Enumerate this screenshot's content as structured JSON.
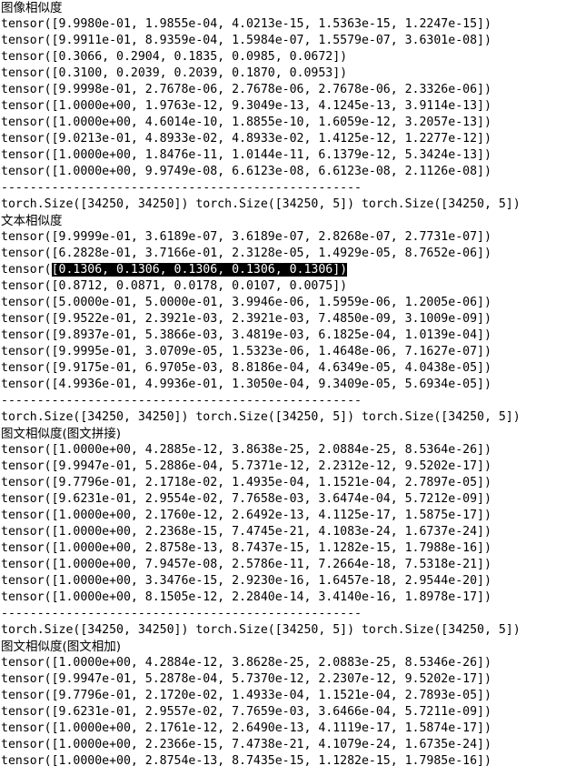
{
  "lines": [
    {
      "kind": "heading",
      "text": "图像相似度"
    },
    {
      "kind": "text",
      "text": "tensor([9.9980e-01, 1.9855e-04, 4.0213e-15, 1.5363e-15, 1.2247e-15])"
    },
    {
      "kind": "text",
      "text": "tensor([9.9911e-01, 8.9359e-04, 1.5984e-07, 1.5579e-07, 3.6301e-08])"
    },
    {
      "kind": "text",
      "text": "tensor([0.3066, 0.2904, 0.1835, 0.0985, 0.0672])"
    },
    {
      "kind": "text",
      "text": "tensor([0.3100, 0.2039, 0.2039, 0.1870, 0.0953])"
    },
    {
      "kind": "text",
      "text": "tensor([9.9998e-01, 2.7678e-06, 2.7678e-06, 2.7678e-06, 2.3326e-06])"
    },
    {
      "kind": "text",
      "text": "tensor([1.0000e+00, 1.9763e-12, 9.3049e-13, 4.1245e-13, 3.9114e-13])"
    },
    {
      "kind": "text",
      "text": "tensor([1.0000e+00, 4.6014e-10, 1.8855e-10, 1.6059e-12, 3.2057e-13])"
    },
    {
      "kind": "text",
      "text": "tensor([9.0213e-01, 4.8933e-02, 4.8933e-02, 1.4125e-12, 1.2277e-12])"
    },
    {
      "kind": "text",
      "text": "tensor([1.0000e+00, 1.8476e-11, 1.0144e-11, 6.1379e-12, 5.3424e-13])"
    },
    {
      "kind": "text",
      "text": "tensor([1.0000e+00, 9.9749e-08, 6.6123e-08, 6.6123e-08, 2.1126e-08])"
    },
    {
      "kind": "sep",
      "text": "--------------------------------------------------"
    },
    {
      "kind": "text",
      "text": "torch.Size([34250, 34250]) torch.Size([34250, 5]) torch.Size([34250, 5])"
    },
    {
      "kind": "heading",
      "text": "文本相似度"
    },
    {
      "kind": "text",
      "text": "tensor([9.9999e-01, 3.6189e-07, 3.6189e-07, 2.8268e-07, 2.7731e-07])"
    },
    {
      "kind": "text",
      "text": "tensor([6.2828e-01, 3.7166e-01, 2.3128e-05, 1.4929e-05, 8.7652e-06])"
    },
    {
      "kind": "highlight",
      "prefix": "tensor(",
      "text": "[0.1306, 0.1306, 0.1306, 0.1306, 0.1306])"
    },
    {
      "kind": "text",
      "text": "tensor([0.8712, 0.0871, 0.0178, 0.0107, 0.0075])"
    },
    {
      "kind": "text",
      "text": "tensor([5.0000e-01, 5.0000e-01, 3.9946e-06, 1.5959e-06, 1.2005e-06])"
    },
    {
      "kind": "text",
      "text": "tensor([9.9522e-01, 2.3921e-03, 2.3921e-03, 7.4850e-09, 3.1009e-09])"
    },
    {
      "kind": "text",
      "text": "tensor([9.8937e-01, 5.3866e-03, 3.4819e-03, 6.1825e-04, 1.0139e-04])"
    },
    {
      "kind": "text",
      "text": "tensor([9.9995e-01, 3.0709e-05, 1.5323e-06, 1.4648e-06, 7.1627e-07])"
    },
    {
      "kind": "text",
      "text": "tensor([9.9175e-01, 6.9705e-03, 8.8186e-04, 4.6349e-05, 4.0438e-05])"
    },
    {
      "kind": "text",
      "text": "tensor([4.9936e-01, 4.9936e-01, 1.3050e-04, 9.3409e-05, 5.6934e-05])"
    },
    {
      "kind": "sep",
      "text": "--------------------------------------------------"
    },
    {
      "kind": "text",
      "text": "torch.Size([34250, 34250]) torch.Size([34250, 5]) torch.Size([34250, 5])"
    },
    {
      "kind": "heading",
      "text": "图文相似度(图文拼接)"
    },
    {
      "kind": "text",
      "text": "tensor([1.0000e+00, 4.2885e-12, 3.8638e-25, 2.0884e-25, 8.5364e-26])"
    },
    {
      "kind": "text",
      "text": "tensor([9.9947e-01, 5.2886e-04, 5.7371e-12, 2.2312e-12, 9.5202e-17])"
    },
    {
      "kind": "text",
      "text": "tensor([9.7796e-01, 2.1718e-02, 1.4935e-04, 1.1521e-04, 2.7897e-05])"
    },
    {
      "kind": "text",
      "text": "tensor([9.6231e-01, 2.9554e-02, 7.7658e-03, 3.6474e-04, 5.7212e-09])"
    },
    {
      "kind": "text",
      "text": "tensor([1.0000e+00, 2.1760e-12, 2.6492e-13, 4.1125e-17, 1.5875e-17])"
    },
    {
      "kind": "text",
      "text": "tensor([1.0000e+00, 2.2368e-15, 7.4745e-21, 4.1083e-24, 1.6737e-24])"
    },
    {
      "kind": "text",
      "text": "tensor([1.0000e+00, 2.8758e-13, 8.7437e-15, 1.1282e-15, 1.7988e-16])"
    },
    {
      "kind": "text",
      "text": "tensor([1.0000e+00, 7.9457e-08, 2.5786e-11, 7.2664e-18, 7.5318e-21])"
    },
    {
      "kind": "text",
      "text": "tensor([1.0000e+00, 3.3476e-15, 2.9230e-16, 1.6457e-18, 2.9544e-20])"
    },
    {
      "kind": "text",
      "text": "tensor([1.0000e+00, 8.1505e-12, 2.2840e-14, 3.4140e-16, 1.8978e-17])"
    },
    {
      "kind": "sep",
      "text": "--------------------------------------------------"
    },
    {
      "kind": "text",
      "text": "torch.Size([34250, 34250]) torch.Size([34250, 5]) torch.Size([34250, 5])"
    },
    {
      "kind": "heading",
      "text": "图文相似度(图文相加)"
    },
    {
      "kind": "text",
      "text": "tensor([1.0000e+00, 4.2884e-12, 3.8628e-25, 2.0883e-25, 8.5346e-26])"
    },
    {
      "kind": "text",
      "text": "tensor([9.9947e-01, 5.2878e-04, 5.7370e-12, 2.2307e-12, 9.5202e-17])"
    },
    {
      "kind": "text",
      "text": "tensor([9.7796e-01, 2.1720e-02, 1.4933e-04, 1.1521e-04, 2.7893e-05])"
    },
    {
      "kind": "text",
      "text": "tensor([9.6231e-01, 2.9557e-02, 7.7659e-03, 3.6466e-04, 5.7211e-09])"
    },
    {
      "kind": "text",
      "text": "tensor([1.0000e+00, 2.1761e-12, 2.6490e-13, 4.1119e-17, 1.5874e-17])"
    },
    {
      "kind": "text",
      "text": "tensor([1.0000e+00, 2.2366e-15, 7.4738e-21, 4.1079e-24, 1.6735e-24])"
    },
    {
      "kind": "text",
      "text": "tensor([1.0000e+00, 2.8754e-13, 8.7435e-15, 1.1282e-15, 1.7985e-16])"
    }
  ]
}
